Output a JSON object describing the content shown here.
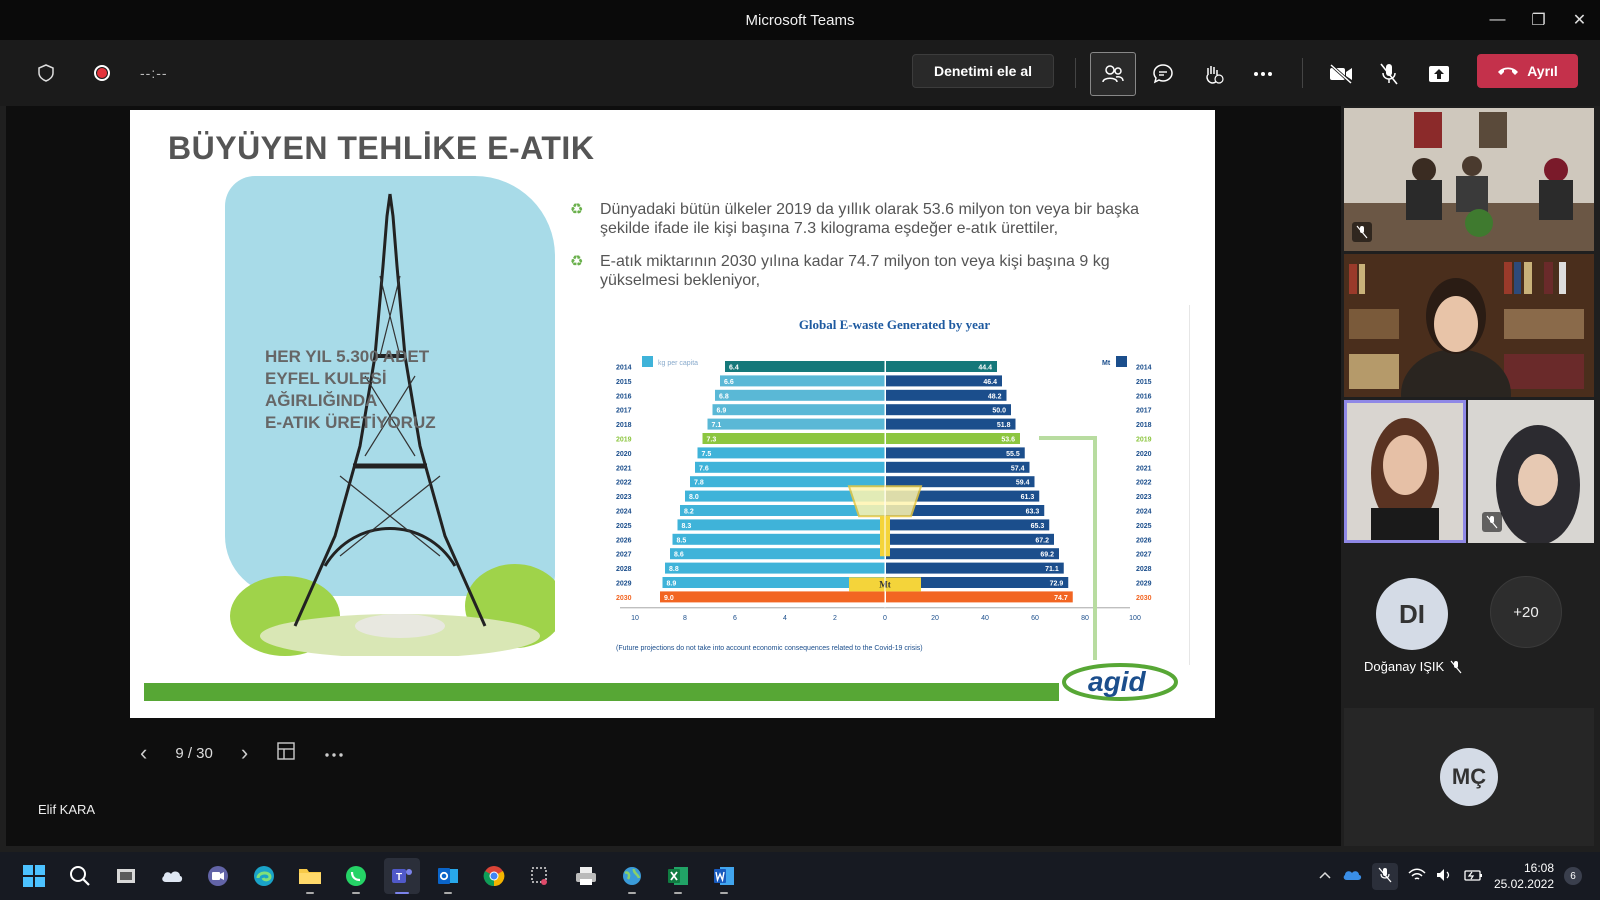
{
  "window": {
    "title": "Microsoft Teams"
  },
  "toolbar": {
    "timer": "--:--",
    "take_control": "Denetimi ele al",
    "leave_label": "Ayrıl"
  },
  "slide": {
    "title": "BÜYÜYEN TEHLİKE E-ATIK",
    "left_text": [
      "HER YIL 5.300 ADET",
      "EYFEL KULESİ",
      "AĞIRLIĞINDA",
      "E-ATIK ÜRETİYORUZ"
    ],
    "bullets": [
      "Dünyadaki bütün ülkeler 2019 da yıllık olarak 53.6 milyon ton veya bir başka şekilde ifade ile kişi başına 7.3 kilograma eşdeğer e-atık ürettiler,",
      "E-atık miktarının 2030 yılına kadar 74.7 milyon ton veya kişi başına  9 kg yükselmesi bekleniyor,"
    ],
    "logo": "agid",
    "nav": {
      "position": "9 / 30"
    }
  },
  "chart_data": {
    "type": "bar",
    "title": "Global E-waste Generated by year",
    "legend_left": "kg per capita",
    "legend_right": "Mt",
    "scale_label": "Mt",
    "footnote": "(Future projections do not take into account economic consequences related to the Covid-19 crisis)",
    "categories": [
      "2014",
      "2015",
      "2016",
      "2017",
      "2018",
      "2019",
      "2020",
      "2021",
      "2022",
      "2023",
      "2024",
      "2025",
      "2026",
      "2027",
      "2028",
      "2029",
      "2030"
    ],
    "series": [
      {
        "name": "kg per capita",
        "values": [
          6.4,
          6.6,
          6.8,
          6.9,
          7.1,
          7.3,
          7.5,
          7.6,
          7.8,
          8.0,
          8.2,
          8.3,
          8.5,
          8.6,
          8.8,
          8.9,
          9.0
        ]
      },
      {
        "name": "Mt",
        "values": [
          44.4,
          46.4,
          48.2,
          50.0,
          51.8,
          53.6,
          55.5,
          57.4,
          59.4,
          61.3,
          63.3,
          65.3,
          67.2,
          69.2,
          71.1,
          72.9,
          74.7
        ]
      }
    ],
    "left_ticks": [
      "10",
      "8",
      "6",
      "4",
      "2",
      "0"
    ],
    "right_ticks": [
      "20",
      "40",
      "60",
      "80",
      "100"
    ],
    "left_range": [
      0,
      10
    ],
    "right_range": [
      0,
      100
    ],
    "colors": {
      "past": "#1f8aa6",
      "current": "#8cc63f",
      "future": "#3fb3d9",
      "forecast_end": "#f26522",
      "mt_dark": "#1b4e8c"
    }
  },
  "presenter": {
    "name": "Elif KARA"
  },
  "participants": [
    {
      "initials": "DI",
      "name": "Doğanay IŞIK"
    },
    {
      "initials": "+20"
    },
    {
      "initials": "MÇ"
    }
  ],
  "clock": {
    "time": "16:08",
    "date": "25.02.2022",
    "notifications": "6"
  }
}
